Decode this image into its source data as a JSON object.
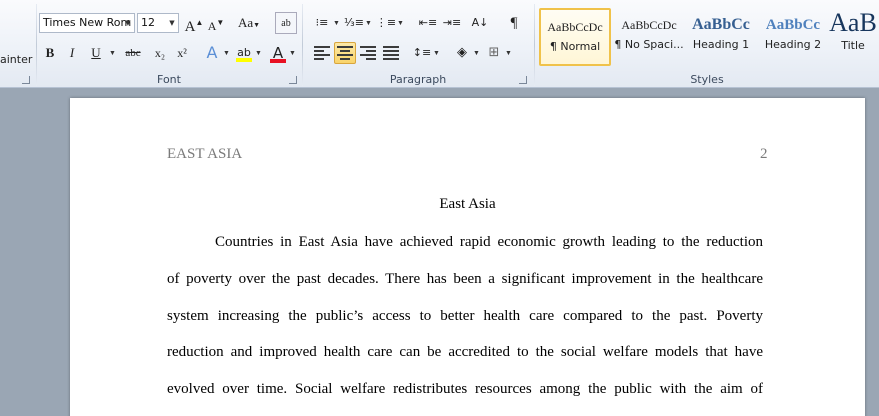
{
  "ribbon": {
    "clipboard": {
      "painter_label": "ainter"
    },
    "font": {
      "group_label": "Font",
      "font_name": "Times New Rom",
      "font_size": "12",
      "grow_label": "A",
      "shrink_label": "A",
      "change_case_label": "Aa",
      "bold_label": "B",
      "italic_label": "I",
      "underline_label": "U",
      "strike_label": "abc",
      "subscript_label": "x₂",
      "superscript_label": "x²",
      "text_effects_label": "A",
      "font_color_label": "A",
      "highlight_color": "#ffff00",
      "font_color": "#e81123"
    },
    "paragraph": {
      "group_label": "Paragraph",
      "show_marks_label": "¶"
    },
    "styles": {
      "group_label": "Styles",
      "items": [
        {
          "sample": "AaBbCcDc",
          "name": "¶ Normal"
        },
        {
          "sample": "AaBbCcDc",
          "name": "¶ No Spaci..."
        },
        {
          "sample": "AaBbCc",
          "name": "Heading 1"
        },
        {
          "sample": "AaBbCc",
          "name": "Heading 2"
        },
        {
          "sample": "AaB",
          "name": "Title"
        }
      ]
    },
    "colors": {
      "accent": "#f0c24a",
      "heading": "#365f91"
    }
  },
  "document": {
    "header_left": "EAST ASIA",
    "page_number": "2",
    "title": "East Asia",
    "lines": [
      "Countries in East Asia have achieved rapid economic growth leading to the reduction",
      "of poverty over the past decades. There has been a significant improvement in the healthcare",
      "system increasing the public’s access to better health care compared to the past. Poverty",
      "reduction and improved health care can be accredited to the social welfare models that have",
      "evolved over time. Social welfare redistributes resources among the public with the aim of"
    ]
  }
}
